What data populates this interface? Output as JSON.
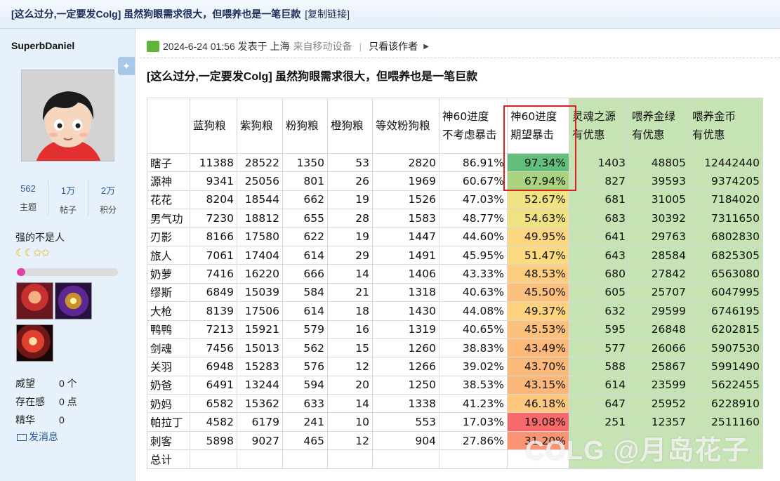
{
  "thread": {
    "title": "[这么过分,一定要发Colg] 虽然狗眼需求很大，但喂养也是一笔巨款",
    "copy_link": "[复制链接]"
  },
  "author": {
    "username": "SuperbDaniel",
    "stats": [
      {
        "value": "562",
        "label": "主题"
      },
      {
        "value": "1万",
        "label": "帖子"
      },
      {
        "value": "2万",
        "label": "积分"
      }
    ],
    "motto": "强的不是人",
    "level_icons": [
      "moon",
      "moon",
      "star",
      "star"
    ],
    "exp_progress": 0.08,
    "info": [
      {
        "key": "威望",
        "value": "0 个"
      },
      {
        "key": "存在感",
        "value": "0 点"
      },
      {
        "key": "精华",
        "value": "0"
      }
    ],
    "send_message": "发消息"
  },
  "post": {
    "datetime": "2024-6-24 01:56",
    "posted_in": "发表于 上海",
    "device": "来自移动设备",
    "only_author": "只看该作者",
    "title": "[这么过分,一定要发Colg] 虽然狗眼需求很大，但喂养也是一笔巨款"
  },
  "table": {
    "headers": [
      {
        "l1": "",
        "l2": ""
      },
      {
        "l1": "蓝狗粮",
        "l2": ""
      },
      {
        "l1": "紫狗粮",
        "l2": ""
      },
      {
        "l1": "粉狗粮",
        "l2": ""
      },
      {
        "l1": "橙狗粮",
        "l2": ""
      },
      {
        "l1": "等效粉狗粮",
        "l2": ""
      },
      {
        "l1": "神60进度",
        "l2": "不考虑暴击"
      },
      {
        "l1": "神60进度",
        "l2": "期望暴击"
      },
      {
        "l1": "灵魂之源",
        "l2": "有优惠"
      },
      {
        "l1": "喂养金绿",
        "l2": "有优惠"
      },
      {
        "l1": "喂养金币",
        "l2": "有优惠"
      }
    ],
    "rows": [
      [
        "瞎子",
        "11388",
        "28522",
        "1350",
        "53",
        "2820",
        "86.91%",
        "97.34%",
        "1403",
        "48805",
        "12442440"
      ],
      [
        "源神",
        "9341",
        "25056",
        "801",
        "26",
        "1969",
        "60.67%",
        "67.94%",
        "827",
        "39593",
        "9374205"
      ],
      [
        "花花",
        "8204",
        "18544",
        "662",
        "19",
        "1526",
        "47.03%",
        "52.67%",
        "681",
        "31005",
        "7184020"
      ],
      [
        "男气功",
        "7230",
        "18812",
        "655",
        "28",
        "1583",
        "48.77%",
        "54.63%",
        "683",
        "30392",
        "7311650"
      ],
      [
        "刃影",
        "8166",
        "17580",
        "622",
        "19",
        "1447",
        "44.60%",
        "49.95%",
        "641",
        "29763",
        "6802830"
      ],
      [
        "旅人",
        "7061",
        "17404",
        "614",
        "29",
        "1491",
        "45.95%",
        "51.47%",
        "643",
        "28584",
        "6825305"
      ],
      [
        "奶萝",
        "7416",
        "16220",
        "666",
        "14",
        "1406",
        "43.33%",
        "48.53%",
        "680",
        "27842",
        "6563080"
      ],
      [
        "缪斯",
        "6849",
        "15039",
        "584",
        "21",
        "1318",
        "40.63%",
        "45.50%",
        "605",
        "25707",
        "6047995"
      ],
      [
        "大枪",
        "8139",
        "17506",
        "614",
        "18",
        "1430",
        "44.08%",
        "49.37%",
        "632",
        "29599",
        "6746195"
      ],
      [
        "鸭鸭",
        "7213",
        "15921",
        "579",
        "16",
        "1319",
        "40.65%",
        "45.53%",
        "595",
        "26848",
        "6202815"
      ],
      [
        "剑魂",
        "7456",
        "15013",
        "562",
        "15",
        "1260",
        "38.83%",
        "43.49%",
        "577",
        "26066",
        "5907530"
      ],
      [
        "关羽",
        "6948",
        "15283",
        "576",
        "12",
        "1266",
        "39.02%",
        "43.70%",
        "588",
        "25867",
        "5991490"
      ],
      [
        "奶爸",
        "6491",
        "13244",
        "594",
        "20",
        "1250",
        "38.53%",
        "43.15%",
        "614",
        "23599",
        "5622455"
      ],
      [
        "奶妈",
        "6582",
        "15362",
        "633",
        "14",
        "1338",
        "41.23%",
        "46.18%",
        "647",
        "25952",
        "6228910"
      ],
      [
        "帕拉丁",
        "4582",
        "6179",
        "241",
        "10",
        "553",
        "17.03%",
        "19.08%",
        "251",
        "12357",
        "2511160"
      ],
      [
        "刺客",
        "5898",
        "9027",
        "465",
        "12",
        "904",
        "27.86%",
        "31.20%",
        "",
        "",
        ""
      ],
      [
        "总计",
        "",
        "",
        "",
        "",
        "",
        "",
        "",
        "",
        "",
        ""
      ]
    ],
    "heat_colors": [
      "#63be7b",
      "#a9d27f",
      "#f1e384",
      "#eee283",
      "#fcd680",
      "#fbda81",
      "#fdce7f",
      "#fcc07c",
      "#fdd27f",
      "#fcc17c",
      "#fcb97a",
      "#fcba7a",
      "#fbb679",
      "#fdc87e",
      "#f8696b",
      "#fa9473",
      "#ffffff"
    ]
  },
  "watermark": "COLG @月岛花子"
}
